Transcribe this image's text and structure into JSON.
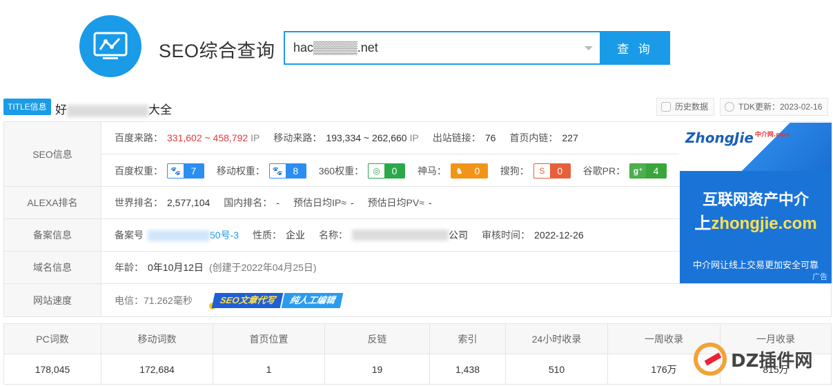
{
  "header": {
    "title": "SEO综合查询",
    "search_value": "hac▒▒▒▒▒.net",
    "search_button": "查 询"
  },
  "title_row": {
    "badge": "TITLE信息",
    "title_prefix": "好",
    "title_suffix": "大全",
    "history_button": "历史数据",
    "tdk_update": "TDK更新：2023-02-16"
  },
  "seo": {
    "label": "SEO信息",
    "baidu_traffic_label": "百度来路：",
    "baidu_traffic_value": "331,602 ~ 458,792",
    "baidu_traffic_unit": "IP",
    "mobile_traffic_label": "移动来路：",
    "mobile_traffic_value": "193,334 ~ 262,660",
    "mobile_traffic_unit": "IP",
    "outbound_label": "出站链接：",
    "outbound_value": "76",
    "inner_label": "首页内链：",
    "inner_value": "227",
    "weights": [
      {
        "label": "百度权重：",
        "value": "7",
        "icon": "paw-icon",
        "glyph": "🐾"
      },
      {
        "label": "移动权重：",
        "value": "8",
        "icon": "paw-icon",
        "glyph": "🐾"
      },
      {
        "label": "360权重：",
        "value": "0",
        "icon": "360-icon",
        "glyph": "◎"
      },
      {
        "label": "神马：",
        "value": "0",
        "icon": "shenma-icon",
        "glyph": "♞"
      },
      {
        "label": "搜狗：",
        "value": "0",
        "icon": "sogou-icon",
        "glyph": "S"
      },
      {
        "label": "谷歌PR：",
        "value": "4",
        "icon": "google-plus-icon",
        "glyph": "g⁺"
      }
    ]
  },
  "alexa": {
    "label": "ALEXA排名",
    "world_label": "世界排名：",
    "world_value": "2,577,104",
    "domestic_label": "国内排名：",
    "domestic_value": "-",
    "ip_label": "预估日均IP≈",
    "ip_value": "-",
    "pv_label": "预估日均PV≈",
    "pv_value": "-"
  },
  "icp": {
    "label": "备案信息",
    "number_label": "备案号",
    "number_suffix": "50号-3",
    "nature_label": "性质：",
    "nature_value": "企业",
    "name_label": "名称：",
    "name_suffix": "公司",
    "audit_label": "审核时间：",
    "audit_value": "2022-12-26"
  },
  "domain": {
    "label": "域名信息",
    "age_label": "年龄：",
    "age_value": "0年10月12日",
    "created": "(创建于2022年04月25日)"
  },
  "speed": {
    "label": "网站速度",
    "value": "电信：71.262毫秒",
    "promo1": "SEO文章代写",
    "promo2": "纯人工编辑"
  },
  "ad": {
    "logo": "ZhongJie",
    "logo_small": "中介网.com",
    "line1": "互联网资产中介",
    "line2_prefix": "上",
    "line2_domain": "zhongjie.com",
    "sub": "中介网让线上交易更加安全可靠",
    "tag": "广告"
  },
  "stats": {
    "headers": [
      "PC词数",
      "移动词数",
      "首页位置",
      "反链",
      "索引",
      "24小时收录",
      "一周收录",
      "一月收录"
    ],
    "values": [
      "178,045",
      "172,684",
      "1",
      "19",
      "1,438",
      "510",
      "176万",
      "815万"
    ]
  },
  "watermark": "DZ插件网",
  "colors": {
    "accent": "#1a9be8",
    "red": "#e4393c"
  }
}
